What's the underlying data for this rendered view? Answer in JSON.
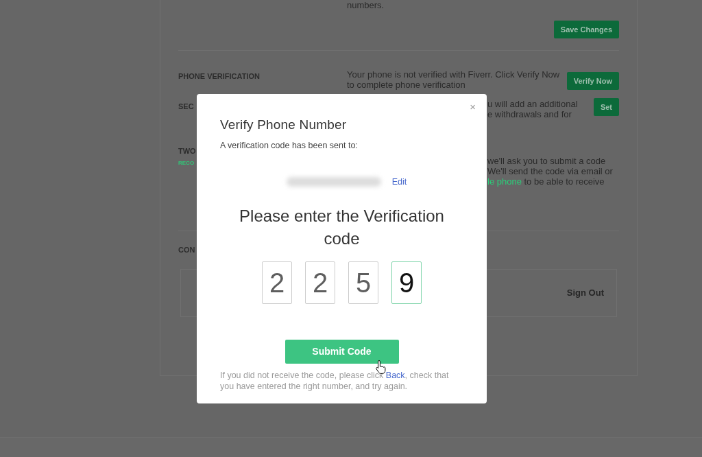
{
  "background": {
    "intro_text": "numbers.",
    "save_button": "Save Changes",
    "phone_verification": {
      "label": "PHONE VERIFICATION",
      "text": "Your phone is not verified with Fiverr. Click Verify Now to complete phone verification",
      "button": "Verify Now"
    },
    "security": {
      "label": "SEC",
      "lines": [
        "u will add an additional",
        "e withdrawals and for"
      ],
      "button": "Set"
    },
    "two_factor": {
      "label": "TWO",
      "badge": "RECO",
      "lines": [
        "we'll ask you to submit a code",
        "We'll send the code via email or"
      ],
      "last_line": {
        "link": "le phone",
        "text": " to be able to receive"
      }
    },
    "connected": {
      "label": "CON",
      "button": "Sign Out"
    }
  },
  "modal": {
    "close": "×",
    "title": "Verify Phone Number",
    "subtitle": "A verification code has been sent to:",
    "edit_link": "Edit",
    "prompt": "Please enter the Verification code",
    "digits": [
      {
        "value": "2",
        "focused": false
      },
      {
        "value": "2",
        "focused": false
      },
      {
        "value": "5",
        "focused": false
      },
      {
        "value": "9",
        "focused": true
      }
    ],
    "submit": "Submit Code",
    "help": {
      "before": "If you did not receive the code, please click ",
      "link": "Back",
      "after": ", check that you have entered the right number, and try again."
    }
  }
}
